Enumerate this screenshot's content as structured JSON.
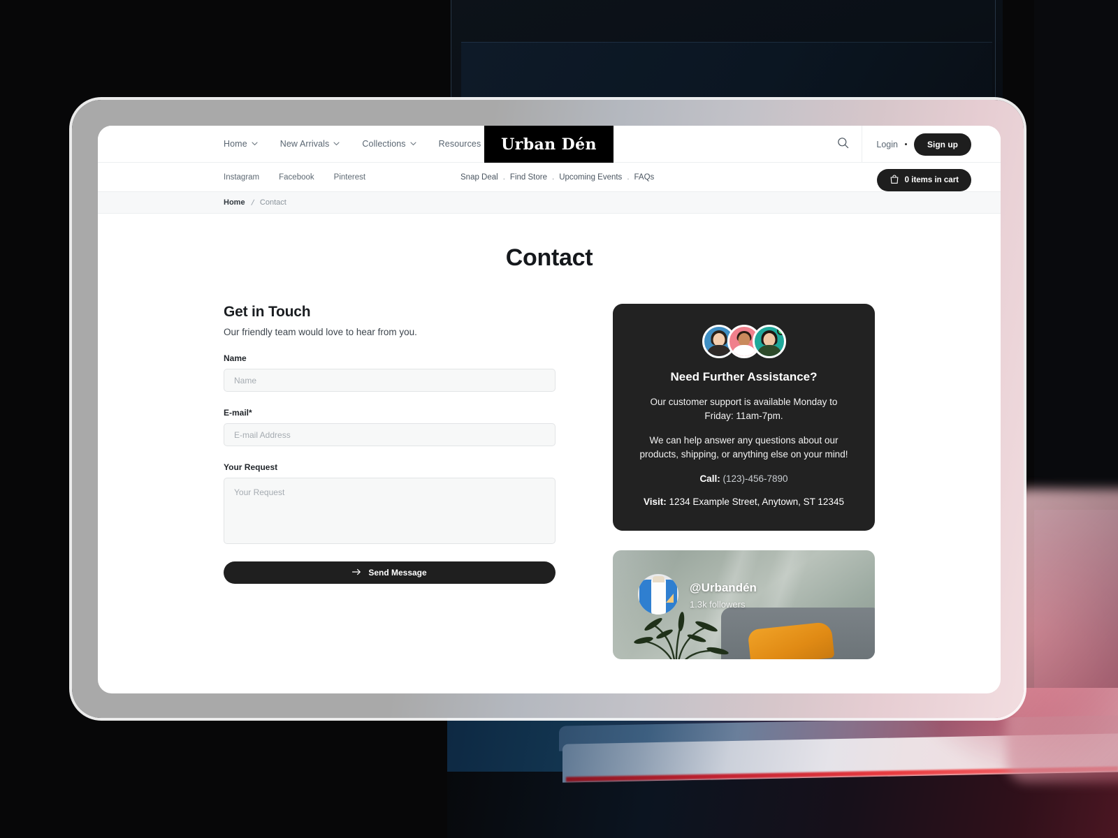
{
  "site": {
    "logo": "Urban Dén"
  },
  "nav": {
    "items": [
      {
        "label": "Home",
        "icon": "chevron-down-icon"
      },
      {
        "label": "New Arrivals",
        "icon": "chevron-down-icon"
      },
      {
        "label": "Collections",
        "icon": "chevron-down-icon"
      },
      {
        "label": "Resources",
        "icon": "chevron-down-icon"
      }
    ],
    "search_icon": "search-icon",
    "login_label": "Login",
    "signup_label": "Sign up"
  },
  "subnav": {
    "social": [
      "Instagram",
      "Facebook",
      "Pinterest"
    ],
    "quick_links": [
      "Snap Deal",
      "Find Store",
      "Upcoming Events",
      "FAQs"
    ],
    "separator": ".",
    "cart_label": "0 items in cart",
    "cart_icon": "bag-icon"
  },
  "breadcrumb": {
    "home": "Home",
    "separator": "/",
    "current": "Contact"
  },
  "page": {
    "title": "Contact"
  },
  "form": {
    "heading": "Get in Touch",
    "subheading": "Our friendly team would love to hear from you.",
    "name_label": "Name",
    "name_placeholder": "Name",
    "email_label": "E-mail*",
    "email_placeholder": "E-mail Address",
    "request_label": "Your Request",
    "request_placeholder": "Your Request",
    "submit_label": "Send Message",
    "submit_icon": "arrow-right-icon"
  },
  "support": {
    "title": "Need Further Assistance?",
    "paragraph1": "Our customer support is available Monday to Friday: 11am-7pm.",
    "paragraph2": "We can help answer any questions about our products, shipping, or anything else on your mind!",
    "call_label": "Call:",
    "call_value": "(123)-456-7890",
    "visit_label": "Visit:",
    "visit_value": "1234 Example Street, Anytown, ST 12345",
    "avatar_count": 3,
    "online_indicator": "online-status-dot"
  },
  "instagram": {
    "handle": "@Urbandén",
    "followers": "1.3k followers",
    "avatar_icon": "shirt-icon"
  },
  "colors": {
    "accent_dark": "#1e1e1e",
    "card_bg": "#222222",
    "page_bg": "#ffffff",
    "crumb_bg": "#f7f8f9",
    "input_bg": "#f7f8f8",
    "online_green": "#3ddc6f"
  }
}
